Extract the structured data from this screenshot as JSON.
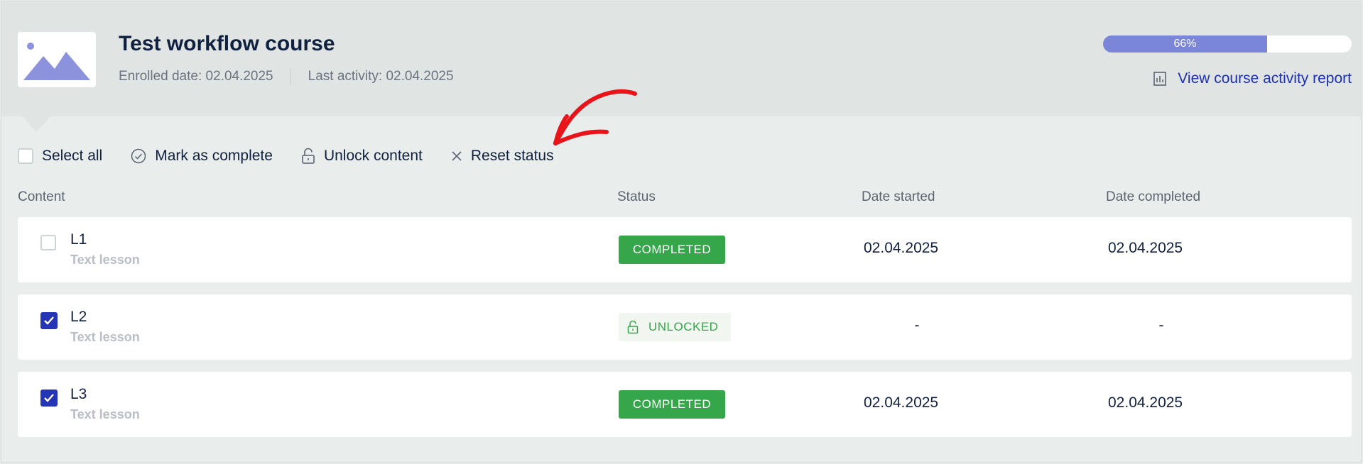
{
  "course": {
    "title": "Test workflow course",
    "enrolled": "Enrolled date: 02.04.2025",
    "last_activity": "Last activity: 02.04.2025",
    "thumbnail_icon": "image-icon"
  },
  "progress": {
    "percent": 66,
    "label": "66%"
  },
  "report_link": {
    "label": "View course activity report",
    "icon": "bar-chart-icon"
  },
  "toolbar": {
    "select_all": "Select all",
    "mark_complete": "Mark as complete",
    "unlock": "Unlock content",
    "reset": "Reset status"
  },
  "columns": {
    "content": "Content",
    "status": "Status",
    "date_started": "Date started",
    "date_completed": "Date completed"
  },
  "rows": [
    {
      "name": "L1",
      "type": "Text lesson",
      "checked": false,
      "status": "COMPLETED",
      "started": "02.04.2025",
      "completed": "02.04.2025"
    },
    {
      "name": "L2",
      "type": "Text lesson",
      "checked": true,
      "status": "UNLOCKED",
      "started": "-",
      "completed": "-"
    },
    {
      "name": "L3",
      "type": "Text lesson",
      "checked": true,
      "status": "COMPLETED",
      "started": "02.04.2025",
      "completed": "02.04.2025"
    }
  ],
  "colors": {
    "accent": "#2435b5",
    "progress_fill": "#7c86d9",
    "completed": "#35a64a",
    "annotation": "#e8141a"
  }
}
